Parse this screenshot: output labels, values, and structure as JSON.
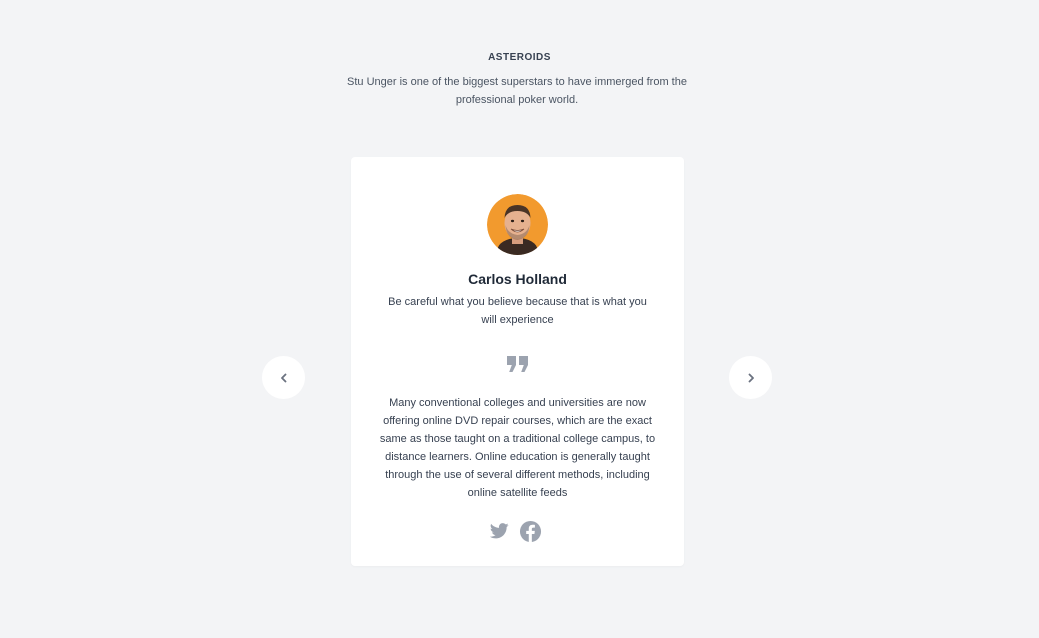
{
  "header": {
    "eyebrow": "ASTEROIDS",
    "subtitle": "Stu Unger is one of the biggest superstars to have immerged from the professional poker world."
  },
  "testimonial": {
    "avatar_icon": "person-avatar",
    "name": "Carlos Holland",
    "tagline": "Be careful what you believe because that is what you will experience",
    "quote_icon": "quote-icon",
    "body": "Many conventional colleges and universities are now offering online DVD repair courses, which are the exact same as those taught on a traditional college campus, to distance learners. Online education is generally taught through the use of several different methods, including online satellite feeds",
    "socials": [
      {
        "icon": "twitter-icon"
      },
      {
        "icon": "facebook-icon"
      }
    ]
  },
  "navigation": {
    "prev_icon": "chevron-left-icon",
    "next_icon": "chevron-right-icon"
  },
  "colors": {
    "background": "#f3f4f6",
    "card": "#ffffff",
    "icon_gray": "#9ca3af",
    "avatar_orange": "#f29a2e"
  }
}
